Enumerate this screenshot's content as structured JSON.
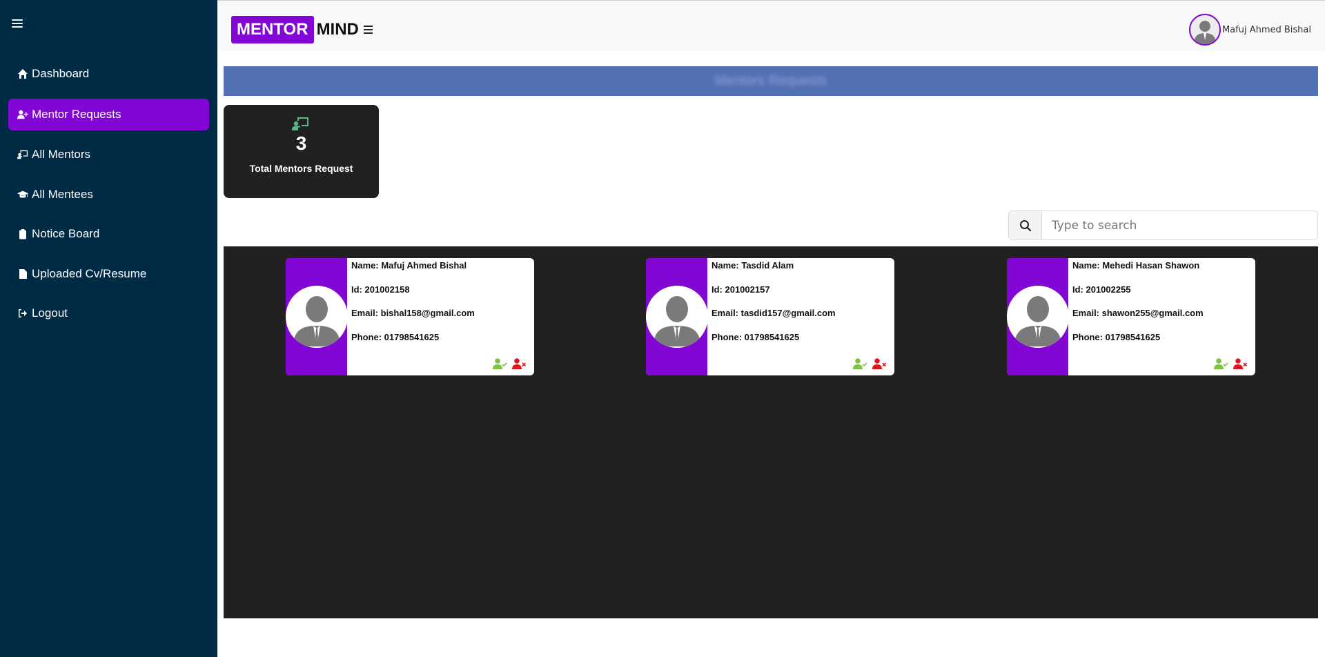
{
  "sidebar": {
    "items": [
      {
        "label": "Dashboard",
        "icon": "home-icon"
      },
      {
        "label": "Mentor Requests",
        "icon": "user-plus-icon",
        "active": true
      },
      {
        "label": "All Mentors",
        "icon": "chalkboard-teacher-icon"
      },
      {
        "label": "All Mentees",
        "icon": "graduation-cap-icon"
      },
      {
        "label": "Notice Board",
        "icon": "clipboard-icon"
      },
      {
        "label": "Uploaded Cv/Resume",
        "icon": "file-icon"
      },
      {
        "label": "Logout",
        "icon": "logout-icon"
      }
    ]
  },
  "header": {
    "logo_mentor": "MENTOR",
    "logo_mind": "MIND",
    "user_name": "Mafuj Ahmed Bishal"
  },
  "banner": {
    "title": "Mentors Requests"
  },
  "stats": {
    "value": "3",
    "label": "Total Mentors Request"
  },
  "search": {
    "placeholder": "Type to search"
  },
  "requests": [
    {
      "name": "Name: Mafuj Ahmed Bishal",
      "id": "Id: 201002158",
      "email": "Email: bishal158@gmail.com",
      "phone": "Phone: 01798541625"
    },
    {
      "name": "Name: Tasdid Alam",
      "id": "Id: 201002157",
      "email": "Email: tasdid157@gmail.com",
      "phone": "Phone: 01798541625"
    },
    {
      "name": "Name: Mehedi Hasan Shawon",
      "id": "Id: 201002255",
      "email": "Email: shawon255@gmail.com",
      "phone": "Phone: 01798541625"
    }
  ],
  "colors": {
    "sidebar_bg": "#002b45",
    "accent": "#8206d4",
    "banner_bg": "#5470b4",
    "panel_bg": "#212121",
    "accept_green": "#7cc242",
    "reject_red": "#e0141e"
  }
}
